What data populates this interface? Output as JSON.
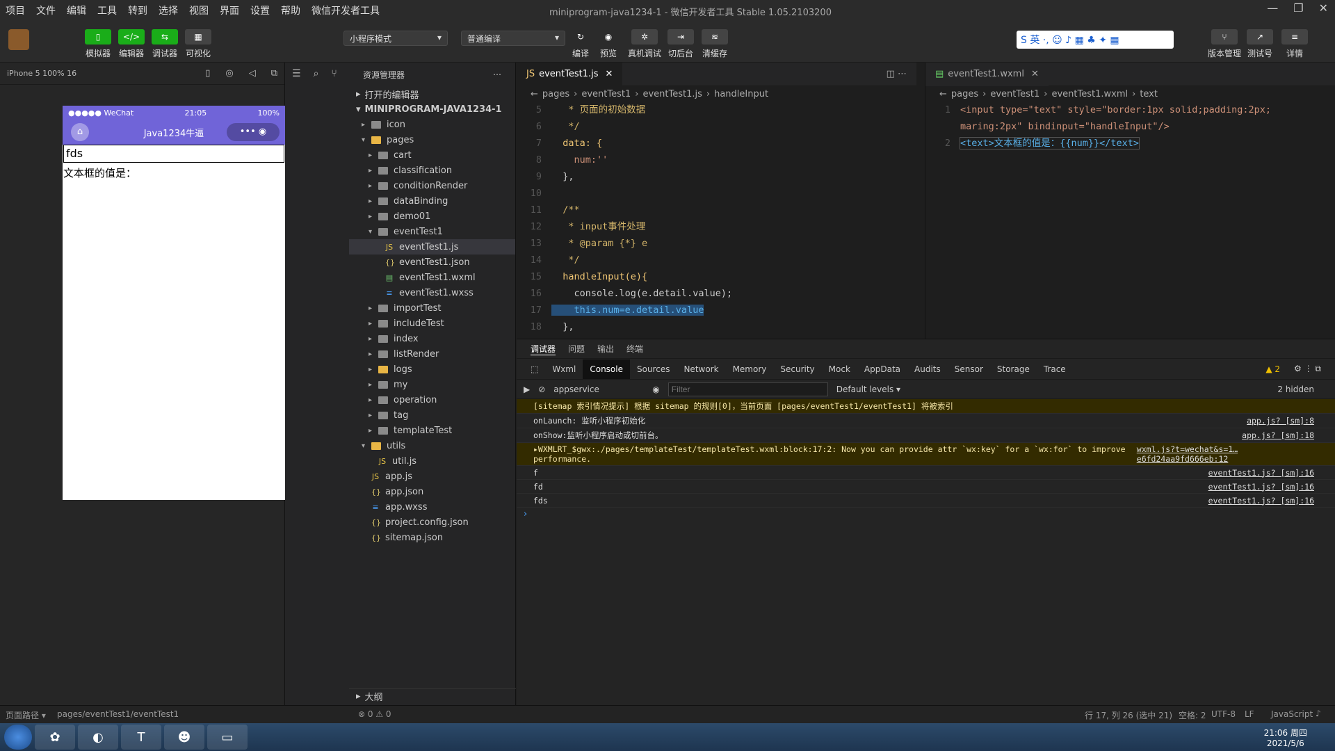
{
  "menu": [
    "项目",
    "文件",
    "编辑",
    "工具",
    "转到",
    "选择",
    "视图",
    "界面",
    "设置",
    "帮助",
    "微信开发者工具"
  ],
  "window_title": "miniprogram-java1234-1 - 微信开发者工具 Stable 1.05.2103200",
  "toolbar": {
    "left_buttons": [
      "模拟器",
      "编辑器",
      "调试器",
      "可视化"
    ],
    "mode_select": "小程序模式",
    "compile_select": "普通编译",
    "mid_buttons": [
      "编译",
      "预览",
      "真机调试",
      "切后台",
      "清缓存"
    ],
    "right_buttons": [
      "版本管理",
      "测试号",
      "详情"
    ]
  },
  "simulator": {
    "device": "iPhone 5 100% 16",
    "status_left": "●●●●● WeChat",
    "status_time": "21:05",
    "status_right": "100%",
    "nav_title": "Java1234牛逼",
    "input_value": "fds",
    "text_label": "文本框的值是："
  },
  "explorer": {
    "title": "资源管理器",
    "open_editors": "打开的编辑器",
    "project": "MINIPROGRAM-JAVA1234-1",
    "outline": "大纲",
    "items": [
      {
        "name": "icon",
        "type": "folder",
        "indent": 1
      },
      {
        "name": "pages",
        "type": "folder",
        "indent": 1,
        "open": true
      },
      {
        "name": "cart",
        "type": "folder",
        "indent": 2
      },
      {
        "name": "classification",
        "type": "folder",
        "indent": 2
      },
      {
        "name": "conditionRender",
        "type": "folder",
        "indent": 2
      },
      {
        "name": "dataBinding",
        "type": "folder",
        "indent": 2
      },
      {
        "name": "demo01",
        "type": "folder",
        "indent": 2
      },
      {
        "name": "eventTest1",
        "type": "folder",
        "indent": 2,
        "open": true
      },
      {
        "name": "eventTest1.js",
        "type": "js",
        "indent": 3,
        "active": true
      },
      {
        "name": "eventTest1.json",
        "type": "json",
        "indent": 3
      },
      {
        "name": "eventTest1.wxml",
        "type": "wxml",
        "indent": 3
      },
      {
        "name": "eventTest1.wxss",
        "type": "wxss",
        "indent": 3
      },
      {
        "name": "importTest",
        "type": "folder",
        "indent": 2
      },
      {
        "name": "includeTest",
        "type": "folder",
        "indent": 2
      },
      {
        "name": "index",
        "type": "folder",
        "indent": 2
      },
      {
        "name": "listRender",
        "type": "folder",
        "indent": 2
      },
      {
        "name": "logs",
        "type": "folder",
        "indent": 2
      },
      {
        "name": "my",
        "type": "folder",
        "indent": 2
      },
      {
        "name": "operation",
        "type": "folder",
        "indent": 2
      },
      {
        "name": "tag",
        "type": "folder",
        "indent": 2
      },
      {
        "name": "templateTest",
        "type": "folder",
        "indent": 2
      },
      {
        "name": "utils",
        "type": "folder",
        "indent": 1,
        "open": true
      },
      {
        "name": "util.js",
        "type": "js",
        "indent": 2
      },
      {
        "name": "app.js",
        "type": "js",
        "indent": 1
      },
      {
        "name": "app.json",
        "type": "json",
        "indent": 1
      },
      {
        "name": "app.wxss",
        "type": "wxss",
        "indent": 1
      },
      {
        "name": "project.config.json",
        "type": "json",
        "indent": 1
      },
      {
        "name": "sitemap.json",
        "type": "json",
        "indent": 1
      }
    ]
  },
  "editor1": {
    "tab": "eventTest1.js",
    "crumbs": [
      "pages",
      "eventTest1",
      "eventTest1.js",
      "handleInput"
    ],
    "lines": [
      {
        "n": "5",
        "text": "   * 页面的初始数据",
        "cls": "c"
      },
      {
        "n": "6",
        "text": "   */",
        "cls": "c"
      },
      {
        "n": "7",
        "text": "  data: {",
        "cls": "k"
      },
      {
        "n": "8",
        "text": "    num:''",
        "cls": "s"
      },
      {
        "n": "9",
        "text": "  },",
        "cls": ""
      },
      {
        "n": "10",
        "text": "",
        "cls": ""
      },
      {
        "n": "11",
        "text": "  /**",
        "cls": "c"
      },
      {
        "n": "12",
        "text": "   * input事件处理",
        "cls": "c"
      },
      {
        "n": "13",
        "text": "   * @param {*} e",
        "cls": "c"
      },
      {
        "n": "14",
        "text": "   */",
        "cls": "c"
      },
      {
        "n": "15",
        "text": "  handleInput(e){",
        "cls": "k"
      },
      {
        "n": "16",
        "text": "    console.log(e.detail.value);",
        "cls": ""
      },
      {
        "n": "17",
        "text": "    this.num=e.detail.value",
        "cls": "t"
      },
      {
        "n": "18",
        "text": "  },",
        "cls": ""
      }
    ]
  },
  "editor2": {
    "tab": "eventTest1.wxml",
    "crumbs": [
      "pages",
      "eventTest1",
      "eventTest1.wxml",
      "text"
    ],
    "lines": [
      {
        "n": "1",
        "text": "<input type=\"text\" style=\"border:1px solid;padding:2px;"
      },
      {
        "n": "",
        "text": "maring:2px\" bindinput=\"handleInput\"/>"
      },
      {
        "n": "2",
        "text": "<text>文本框的值是：{{num}}</text>"
      }
    ]
  },
  "devtools": {
    "top_tabs": [
      "调试器",
      "问题",
      "输出",
      "终端"
    ],
    "tabs": [
      "Wxml",
      "Console",
      "Sources",
      "Network",
      "Memory",
      "Security",
      "Mock",
      "AppData",
      "Audits",
      "Sensor",
      "Storage",
      "Trace"
    ],
    "warnings_count": "▲ 2",
    "context": "appservice",
    "filter_placeholder": "Filter",
    "levels": "Default levels ▾",
    "hidden": "2 hidden",
    "rows": [
      {
        "warn": true,
        "msg": "[sitemap 索引情况提示] 根据 sitemap 的规则[0]，当前页面 [pages/eventTest1/eventTest1] 将被索引",
        "src": ""
      },
      {
        "warn": false,
        "msg": "onLaunch: 监听小程序初始化",
        "src": "app.js? [sm]:8"
      },
      {
        "warn": false,
        "msg": "onShow:监听小程序启动或切前台。",
        "src": "app.js? [sm]:18"
      },
      {
        "warn": true,
        "msg": "▸WXMLRT_$gwx:./pages/templateTest/templateTest.wxml:block:17:2: Now you can provide attr `wx:key` for a `wx:for` to improve performance.",
        "src": "wxml.js?t=wechat&s=1…e6fd24aa9fd666eb:12"
      },
      {
        "warn": false,
        "msg": "f",
        "src": "eventTest1.js? [sm]:16"
      },
      {
        "warn": false,
        "msg": "fd",
        "src": "eventTest1.js? [sm]:16"
      },
      {
        "warn": false,
        "msg": "fds",
        "src": "eventTest1.js? [sm]:16"
      }
    ]
  },
  "statusbar": {
    "path_label": "页面路径 ▾",
    "path": "pages/eventTest1/eventTest1",
    "problems": "⊗ 0 ⚠ 0",
    "position": "行 17, 列 26 (选中 21)",
    "spaces": "空格: 2",
    "encoding": "UTF-8",
    "eol": "LF",
    "lang": "JavaScript"
  },
  "taskbar": {
    "time": "21:06 周四",
    "date": "2021/5/6"
  }
}
